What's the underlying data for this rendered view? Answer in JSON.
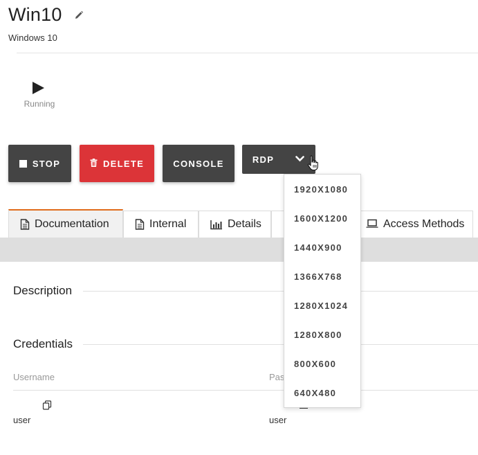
{
  "header": {
    "title": "Win10",
    "subtitle": "Windows 10"
  },
  "status": {
    "label": "Running"
  },
  "actions": {
    "stop_label": "STOP",
    "delete_label": "DELETE",
    "console_label": "CONSOLE",
    "rdp_label": "RDP"
  },
  "tabs": [
    {
      "label": "Documentation",
      "icon": "document-icon",
      "active": true
    },
    {
      "label": "Internal",
      "icon": "document-icon",
      "active": false
    },
    {
      "label": "Details",
      "icon": "bar-chart-icon",
      "active": false
    },
    {
      "label": "Access Methods",
      "icon": "laptop-icon",
      "active": false
    }
  ],
  "documentation": {
    "description_title": "Description",
    "credentials_title": "Credentials",
    "columns": [
      "Username",
      "Pas"
    ],
    "rows": [
      {
        "username": "user",
        "password": "user"
      }
    ]
  },
  "rdp_menu": {
    "items": [
      "1920X1080",
      "1600X1200",
      "1440X900",
      "1366X768",
      "1280X1024",
      "1280X800",
      "800X600",
      "640X480"
    ]
  },
  "colors": {
    "dark_button": "#444444",
    "delete_red": "#dc3438",
    "active_tab_accent": "#e06c1c"
  }
}
